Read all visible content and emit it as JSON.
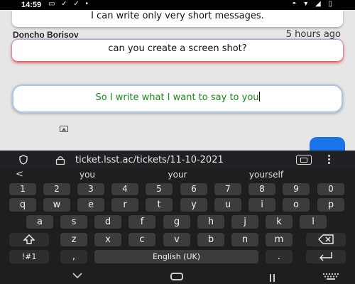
{
  "status_bar": {
    "time": "14:59",
    "left_icons": "▭ ✓ ✓ •",
    "right_icons": "◓ ▾ ◢ ▯"
  },
  "chat": {
    "messages": [
      {
        "text": "I can write only very short messages."
      },
      {
        "sender": "Doncho Borisov",
        "time": "5 hours ago",
        "text": "can you create a screen shot?"
      }
    ],
    "compose_text": "So I write what I want to say to you"
  },
  "browser": {
    "url": "ticket.lsst.ac/tickets/11-10-2021"
  },
  "suggestions": {
    "back": "<",
    "items": [
      "you",
      "your",
      "yourself"
    ]
  },
  "keyboard": {
    "number_row": [
      "1",
      "2",
      "3",
      "4",
      "5",
      "6",
      "7",
      "8",
      "9",
      "0"
    ],
    "row1": [
      "q",
      "w",
      "e",
      "r",
      "t",
      "y",
      "u",
      "i",
      "o",
      "p"
    ],
    "row2": [
      "a",
      "s",
      "d",
      "f",
      "g",
      "h",
      "j",
      "k",
      "l"
    ],
    "row3": [
      "z",
      "x",
      "c",
      "v",
      "b",
      "n",
      "m"
    ],
    "symbols_label": "!#1",
    "comma": ",",
    "space_label": "English (UK)",
    "period": "."
  },
  "colors": {
    "compose_text": "#1a8c1a",
    "send_button": "#1a73e8",
    "keyboard_bg": "#1e1e1e"
  }
}
